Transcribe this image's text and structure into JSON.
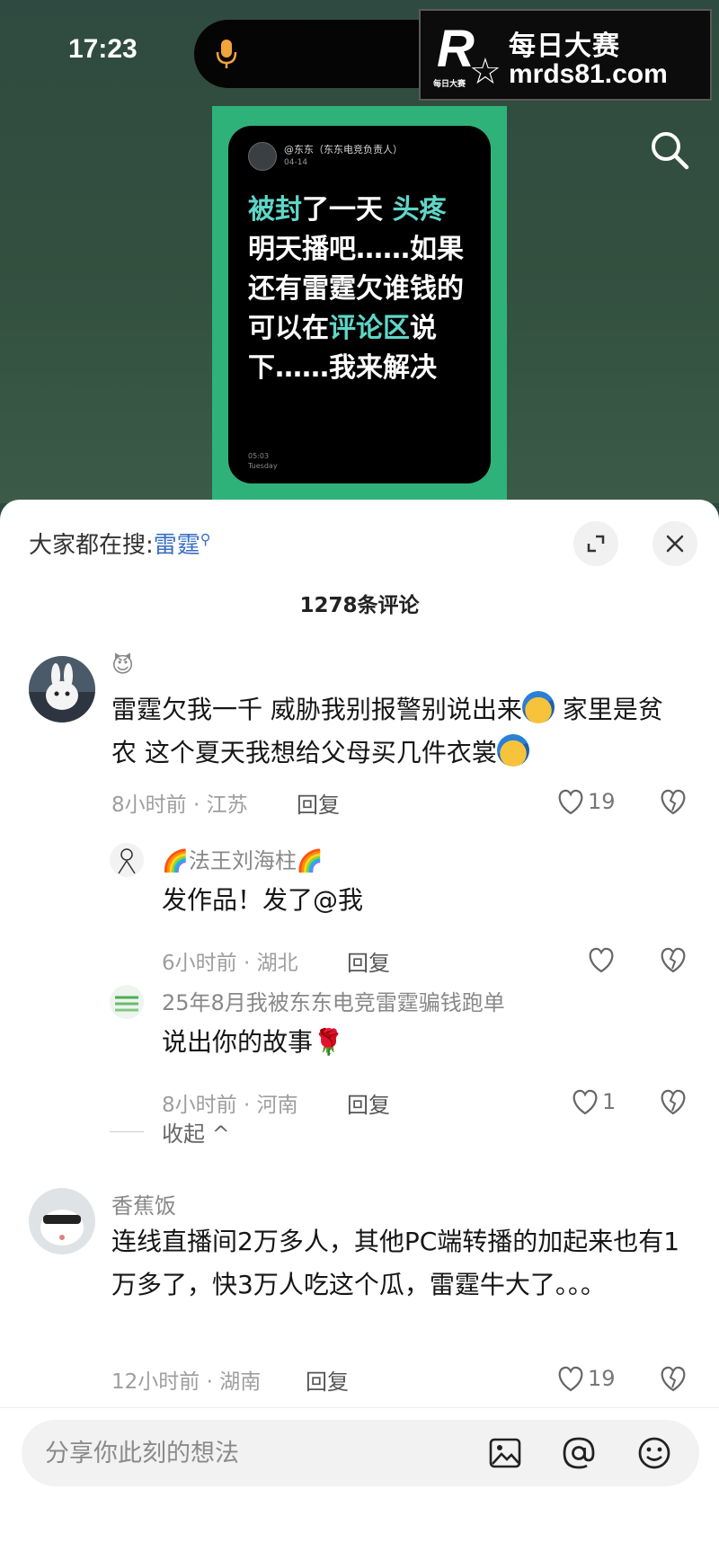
{
  "status_bar": {
    "time": "17:23"
  },
  "watermark": {
    "logo_letter": "R",
    "logo_sub": "每日大赛",
    "title": "每日大赛",
    "url": "mrds81.com"
  },
  "video": {
    "post_author": "@东东（东东电竞负责人）",
    "post_date": "04-14",
    "post_text_parts": [
      "被封",
      "了一天 ",
      "头疼",
      "明天播吧……如果还有雷霆欠谁钱的可以在",
      "评论区",
      "说下……我来解决"
    ],
    "post_time": "05:03",
    "post_day": "Tuesday"
  },
  "sheet": {
    "hot_search_prefix": "大家都在搜:",
    "hot_search_keyword": "雷霆",
    "comment_count": "1278条评论"
  },
  "comments": [
    {
      "name": "😈",
      "text_a": "雷霆欠我一千 威胁我别报警别说出来",
      "text_b": " 家里是贫农 这个夏天我想给父母买几件衣裳",
      "time_loc": "8小时前 · 江苏",
      "reply": "回复",
      "likes": "19"
    },
    {
      "name": "🌈法王刘海柱🌈",
      "text": "发作品！发了@我",
      "time_loc": "6小时前 · 湖北",
      "reply": "回复",
      "likes": ""
    },
    {
      "name": "25年8月我被东东电竞雷霆骗钱跑单",
      "text": "说出你的故事🌹",
      "time_loc": "8小时前 · 河南",
      "reply": "回复",
      "likes": "1"
    },
    {
      "name": "香蕉饭",
      "text": "连线直播间2万多人，其他PC端转播的加起来也有1万多了，快3万人吃这个瓜，雷霆牛大了。。。",
      "time_loc": "12小时前 · 湖南",
      "reply": "回复",
      "likes": "19"
    }
  ],
  "collapse_label": "收起 ^",
  "input": {
    "placeholder": "分享你此刻的想法"
  },
  "icons": {
    "mic": "mic-icon",
    "search": "search-icon",
    "expand": "expand-icon",
    "close": "close-icon",
    "heart": "heart-icon",
    "broken_heart": "broken-heart-icon",
    "image": "image-icon",
    "at": "at-icon",
    "emoji": "emoji-icon"
  },
  "colors": {
    "accent_blue": "#3a6fc4",
    "highlight_cyan": "#5fd6c8",
    "card_green": "#2fb27a",
    "mic_orange": "#f2a33a"
  }
}
